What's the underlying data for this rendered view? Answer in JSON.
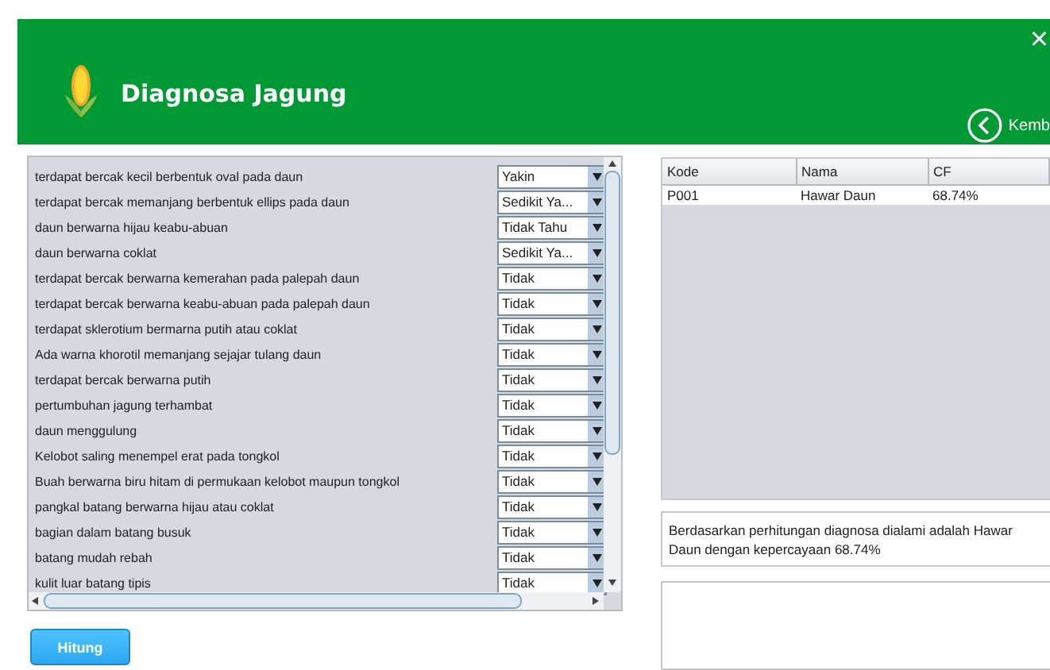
{
  "header": {
    "title": "Diagnosa Jagung",
    "close": "×",
    "back_label": "Kemb"
  },
  "symptoms": [
    {
      "text": "terdapat bercak kecil berbentuk oval pada daun",
      "answer": "Yakin"
    },
    {
      "text": "terdapat bercak memanjang berbentuk ellips pada daun",
      "answer": "Sedikit Ya..."
    },
    {
      "text": "daun berwarna hijau keabu-abuan",
      "answer": "Tidak Tahu"
    },
    {
      "text": "daun berwarna coklat",
      "answer": "Sedikit Ya..."
    },
    {
      "text": "terdapat bercak berwarna kemerahan pada palepah daun",
      "answer": "Tidak"
    },
    {
      "text": "terdapat bercak berwarna keabu-abuan pada palepah daun",
      "answer": "Tidak"
    },
    {
      "text": "terdapat sklerotium bermarna putih atau coklat",
      "answer": "Tidak"
    },
    {
      "text": "Ada warna khorotil memanjang sejajar tulang daun",
      "answer": "Tidak"
    },
    {
      "text": "terdapat bercak berwarna putih",
      "answer": "Tidak"
    },
    {
      "text": "pertumbuhan jagung terhambat",
      "answer": "Tidak"
    },
    {
      "text": "daun menggulung",
      "answer": "Tidak"
    },
    {
      "text": "Kelobot saling menempel erat pada tongkol",
      "answer": "Tidak"
    },
    {
      "text": "Buah berwarna biru hitam di permukaan kelobot maupun tongkol",
      "answer": "Tidak"
    },
    {
      "text": "pangkal batang berwarna hijau atau coklat",
      "answer": "Tidak"
    },
    {
      "text": "bagian dalam batang busuk",
      "answer": "Tidak"
    },
    {
      "text": "batang mudah rebah",
      "answer": "Tidak"
    },
    {
      "text": "kulit luar batang tipis",
      "answer": "Tidak"
    }
  ],
  "button": "Hitung",
  "results": {
    "columns": [
      "Kode",
      "Nama",
      "CF"
    ],
    "rows": [
      [
        "P001",
        "Hawar Daun",
        "68.74%"
      ]
    ]
  },
  "conclusion": "Berdasarkan perhitungan diagnosa dialami adalah Hawar Daun dengan kepercayaan 68.74%"
}
